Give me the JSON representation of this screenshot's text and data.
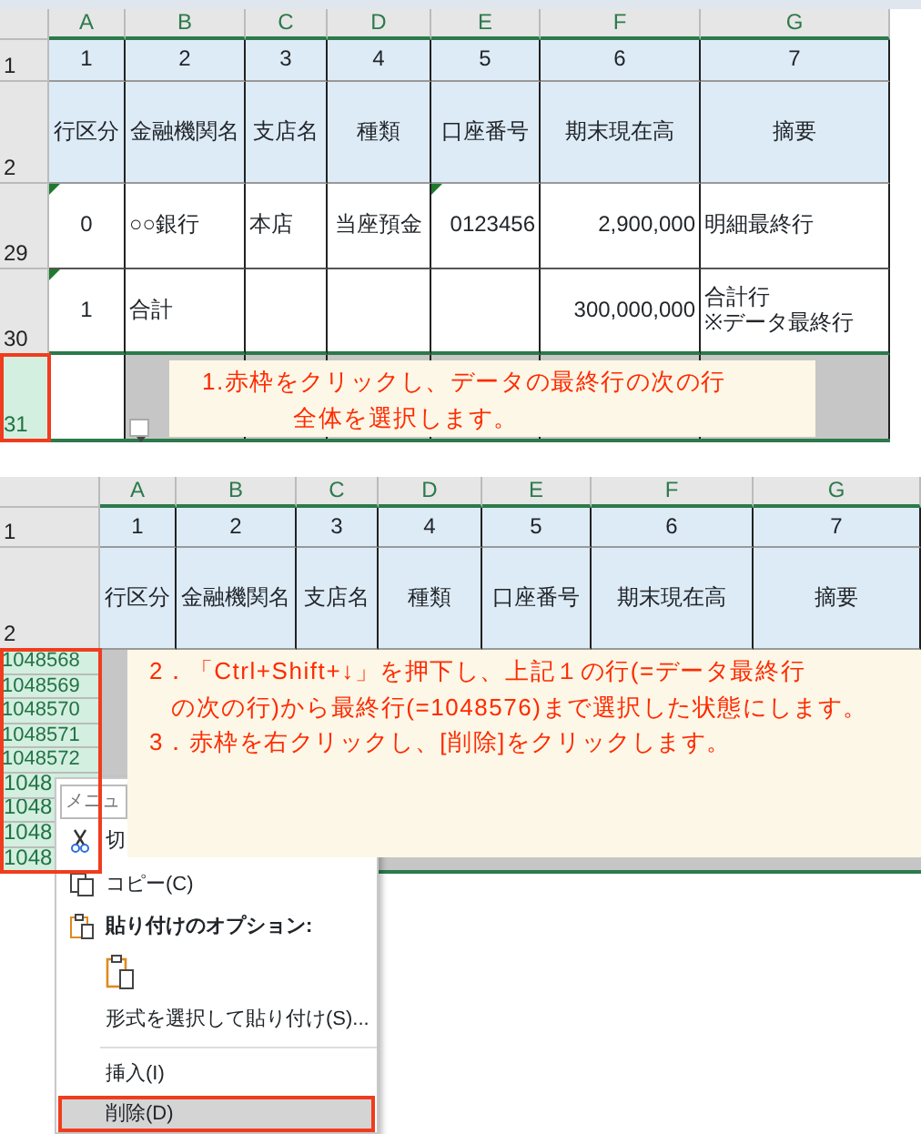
{
  "top_sheet": {
    "columns": [
      "A",
      "B",
      "C",
      "D",
      "E",
      "F",
      "G"
    ],
    "rows": [
      {
        "header": "1",
        "selected": false,
        "kind": "title",
        "cells": [
          {
            "text": "1"
          },
          {
            "text": "2"
          },
          {
            "text": "3"
          },
          {
            "text": "4"
          },
          {
            "text": "5"
          },
          {
            "text": "6"
          },
          {
            "text": "7"
          }
        ]
      },
      {
        "header": "2",
        "selected": false,
        "kind": "title",
        "cells": [
          {
            "text": "行区分"
          },
          {
            "text": "金融機関名"
          },
          {
            "text": "支店名"
          },
          {
            "text": "種類"
          },
          {
            "text": "口座番号"
          },
          {
            "text": "期末現在高"
          },
          {
            "text": "摘要"
          }
        ]
      },
      {
        "header": "29",
        "selected": false,
        "kind": "data",
        "cells": [
          {
            "text": "0",
            "error_mark": true
          },
          {
            "text": "○○銀行",
            "error_mark": false
          },
          {
            "text": "本店",
            "error_mark": false
          },
          {
            "text": "当座預金",
            "error_mark": false
          },
          {
            "text": "0123456",
            "error_mark": true
          },
          {
            "text": "2,900,000",
            "error_mark": false
          },
          {
            "text": "明細最終行",
            "error_mark": false
          }
        ]
      },
      {
        "header": "30",
        "selected": false,
        "kind": "data",
        "cells": [
          {
            "text": "1",
            "error_mark": true
          },
          {
            "text": "合計",
            "error_mark": false
          },
          {
            "error_mark": false
          },
          {
            "error_mark": false
          },
          {
            "error_mark": false
          },
          {
            "text": "300,000,000",
            "error_mark": false
          },
          {
            "text": "合計行\n※データ最終行",
            "error_mark": false
          }
        ]
      },
      {
        "header": "31",
        "selected": true,
        "kind": "data"
      }
    ]
  },
  "callouts": [
    {
      "lines": [
        "1.赤枠をクリックし、データの最終行の次の行",
        "全体を選択します。"
      ]
    },
    {
      "lines": [
        "2．「Ctrl+Shift+↓」を押下し、上記１の行(=データ最終行",
        "の次の行)から最終行(=1048576)まで選択した状態にします。",
        "3．赤枠を右クリックし、[削除]をクリックします。"
      ]
    }
  ],
  "bottom_sheet": {
    "columns": [
      "A",
      "B",
      "C",
      "D",
      "E",
      "F",
      "G"
    ],
    "rows": [
      {
        "header": "1",
        "selected": false,
        "kind": "title",
        "cells": [
          {
            "text": "1"
          },
          {
            "text": "2"
          },
          {
            "text": "3"
          },
          {
            "text": "4"
          },
          {
            "text": "5"
          },
          {
            "text": "6"
          },
          {
            "text": "7"
          }
        ]
      },
      {
        "header": "2",
        "selected": false,
        "kind": "title",
        "cells": [
          {
            "text": "行区分"
          },
          {
            "text": "金融機関名"
          },
          {
            "text": "支店名"
          },
          {
            "text": "種類"
          },
          {
            "text": "口座番号"
          },
          {
            "text": "期末現在高"
          },
          {
            "text": "摘要"
          }
        ]
      },
      {
        "header": "1048568",
        "selected": true,
        "kind": "data"
      },
      {
        "header": "1048569",
        "selected": true,
        "kind": "data"
      },
      {
        "header": "1048570",
        "selected": true,
        "kind": "data"
      },
      {
        "header": "1048571",
        "selected": true,
        "kind": "data"
      },
      {
        "header": "1048572",
        "selected": true,
        "kind": "data"
      },
      {
        "header": "1048",
        "selected": true,
        "kind": "data"
      },
      {
        "header": "1048",
        "selected": true,
        "kind": "data"
      },
      {
        "header": "1048",
        "selected": true,
        "kind": "data"
      },
      {
        "header": "1048",
        "selected": true,
        "kind": "data"
      }
    ]
  },
  "context_menu": {
    "items": [
      {
        "kind": "search",
        "placeholder": "メニュ"
      },
      {
        "kind": "command",
        "label": "切",
        "selected": false
      },
      {
        "kind": "command",
        "label": "コピー(C)",
        "selected": false
      },
      {
        "kind": "heading",
        "label": "貼り付けのオプション:"
      },
      {
        "kind": "paste-option"
      },
      {
        "kind": "command",
        "label": "形式を選択して貼り付け(S)...",
        "selected": false
      },
      {
        "kind": "separator"
      },
      {
        "kind": "command",
        "label": "挿入(I)",
        "selected": false
      },
      {
        "kind": "command",
        "label": "削除(D)",
        "selected": true
      }
    ]
  }
}
